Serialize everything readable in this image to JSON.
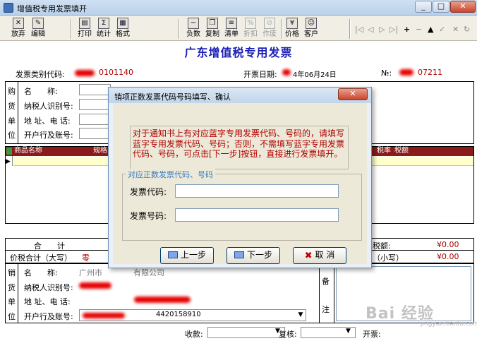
{
  "window": {
    "title": "增值税专用发票填开",
    "min": "_",
    "max": "□",
    "close": "✕"
  },
  "toolbar": {
    "items": [
      {
        "label": "放弃",
        "icon": "discard-icon",
        "glyph": "✕"
      },
      {
        "label": "编辑",
        "icon": "edit-icon",
        "glyph": "✎"
      },
      {
        "label": "打印",
        "icon": "print-icon",
        "glyph": "▤"
      },
      {
        "label": "统计",
        "icon": "sigma-icon",
        "glyph": "Σ"
      },
      {
        "label": "格式",
        "icon": "format-icon",
        "glyph": "▦"
      },
      {
        "label": "负数",
        "icon": "negative-icon",
        "glyph": "−"
      },
      {
        "label": "复制",
        "icon": "copy-icon",
        "glyph": "❐"
      },
      {
        "label": "清单",
        "icon": "list-icon",
        "glyph": "≡"
      },
      {
        "label": "折扣",
        "icon": "discount-icon",
        "glyph": "%"
      },
      {
        "label": "作废",
        "icon": "void-icon",
        "glyph": "⊘"
      },
      {
        "label": "价格",
        "icon": "price-icon",
        "glyph": "¥"
      },
      {
        "label": "客户",
        "icon": "customer-icon",
        "glyph": "☺"
      }
    ],
    "nav_glyphs": [
      "|◁",
      "◁",
      "▷",
      "▷|",
      "+",
      "−",
      "▲",
      "✓",
      "✕",
      "↻"
    ]
  },
  "invoice": {
    "title": "广东增值税专用发票",
    "code_label": "发票类别代码:",
    "date_label": "开票日期:",
    "date_value": "4年06月24日",
    "no_label": "№:",
    "code_value": "0101140",
    "no_value": "07211"
  },
  "buyer": {
    "side_labels": [
      "购",
      "货",
      "单",
      "位"
    ],
    "fields": [
      "名　　称:",
      "纳税人识别号:",
      "地 址、电 话:",
      "开户行及账号:"
    ]
  },
  "goods_grid": {
    "headers": [
      "商品名称",
      "规格",
      "税率",
      "税额"
    ]
  },
  "totals": {
    "sum_label": "合　　计",
    "sum_tax": "¥0.00",
    "tax_label": "税额:",
    "total_label": "价税合计（大写）",
    "total_text": "零",
    "total_lower_label": "（小写）",
    "total_lower": "¥0.00"
  },
  "seller": {
    "side_labels": [
      "销",
      "货",
      "单",
      "位"
    ],
    "fields": [
      "名　　称:",
      "纳税人识别号:",
      "地 址、电 话:",
      "开户行及账号:"
    ],
    "name_value": "广州市　　　　有限公司",
    "bank_value": "4420158910",
    "remark_labels": [
      "备",
      "注"
    ]
  },
  "footer": {
    "receiver_label": "收款:",
    "reviewer_label": "复核:",
    "issuer_label": "开票:"
  },
  "dialog": {
    "title": "销项正数发票代码号码填写、确认",
    "close": "✕",
    "message": "对于通知书上有对应蓝字专用发票代码、号码的，请填写蓝字专用发票代码、号码；否则，不需填写蓝字专用发票代码、号码，可点击[下一步]按钮，直接进行发票填开。",
    "group_caption": "对应正数发票代码、号码",
    "code_label": "发票代码:",
    "number_label": "发票号码:",
    "code_value": "",
    "number_value": "",
    "prev_label": "上一步",
    "next_label": "下一步",
    "cancel_label": "取 消"
  },
  "watermark": {
    "text": "Bai 经验",
    "sub": "jingyan.baidu.com"
  }
}
